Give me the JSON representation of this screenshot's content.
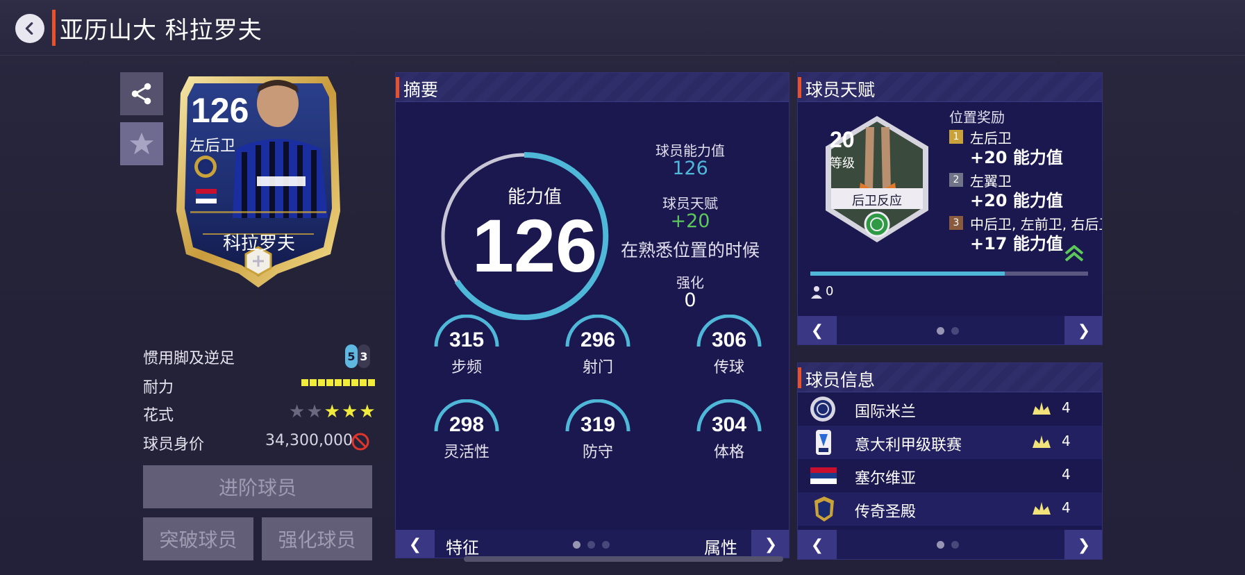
{
  "header": {
    "title": "亚历山大 科拉罗夫"
  },
  "card": {
    "rating": "126",
    "position": "左后卫",
    "name": "科拉罗夫"
  },
  "stats": {
    "foot_label": "惯用脚及逆足",
    "foot_strong": "5",
    "foot_weak": "3",
    "stamina_label": "耐力",
    "stamina_level": 9,
    "skill_label": "花式",
    "skill_stars_total": 5,
    "skill_stars_filled": 3,
    "value_label": "球员身价",
    "value": "34,300,000"
  },
  "buttons": {
    "advance": "进阶球员",
    "breakthrough": "突破球员",
    "enhance": "强化球员"
  },
  "summary": {
    "title": "摘要",
    "ring_label": "能力值",
    "ring_value": "126",
    "ability_label": "球员能力值",
    "ability_value": "126",
    "talent_label": "球员天赋",
    "talent_value": "+20",
    "talent_note": "在熟悉位置的时候",
    "enhance_label": "强化",
    "enhance_value": "0",
    "attributes": [
      {
        "value": "315",
        "label": "步频"
      },
      {
        "value": "296",
        "label": "射门"
      },
      {
        "value": "306",
        "label": "传球"
      },
      {
        "value": "298",
        "label": "灵活性"
      },
      {
        "value": "319",
        "label": "防守"
      },
      {
        "value": "304",
        "label": "体格"
      }
    ],
    "footer_left": "特征",
    "footer_right": "属性",
    "prev_arrow": "❮",
    "next_arrow": "❯"
  },
  "talent": {
    "title": "球员天赋",
    "level": "20",
    "level_label": "等级",
    "skill_name": "后卫反应",
    "bonus_title": "位置奖励",
    "bonuses": [
      {
        "rank": "1",
        "position": "左后卫",
        "value": "+20 能力值",
        "color": "#c9a33a"
      },
      {
        "rank": "2",
        "position": "左翼卫",
        "value": "+20 能力值",
        "color": "#6f7488"
      },
      {
        "rank": "3",
        "position": "中后卫, 左前卫, 右后卫",
        "value": "+17 能力值",
        "color": "#8a5a3c"
      }
    ],
    "progress": 0.7,
    "count": "0",
    "prev_arrow": "❮",
    "next_arrow": "❯"
  },
  "info": {
    "title": "球员信息",
    "rows": [
      {
        "name": "国际米兰",
        "count": "4"
      },
      {
        "name": "意大利甲级联赛",
        "count": "4"
      },
      {
        "name": "塞尔维亚",
        "count": "4"
      },
      {
        "name": "传奇圣殿",
        "count": "4"
      }
    ],
    "prev_arrow": "❮",
    "next_arrow": "❯"
  },
  "colors": {
    "accent": "#e8512a",
    "ring": "#4fb8d9",
    "green": "#5cc85a",
    "yellow": "#f1ec3b"
  }
}
